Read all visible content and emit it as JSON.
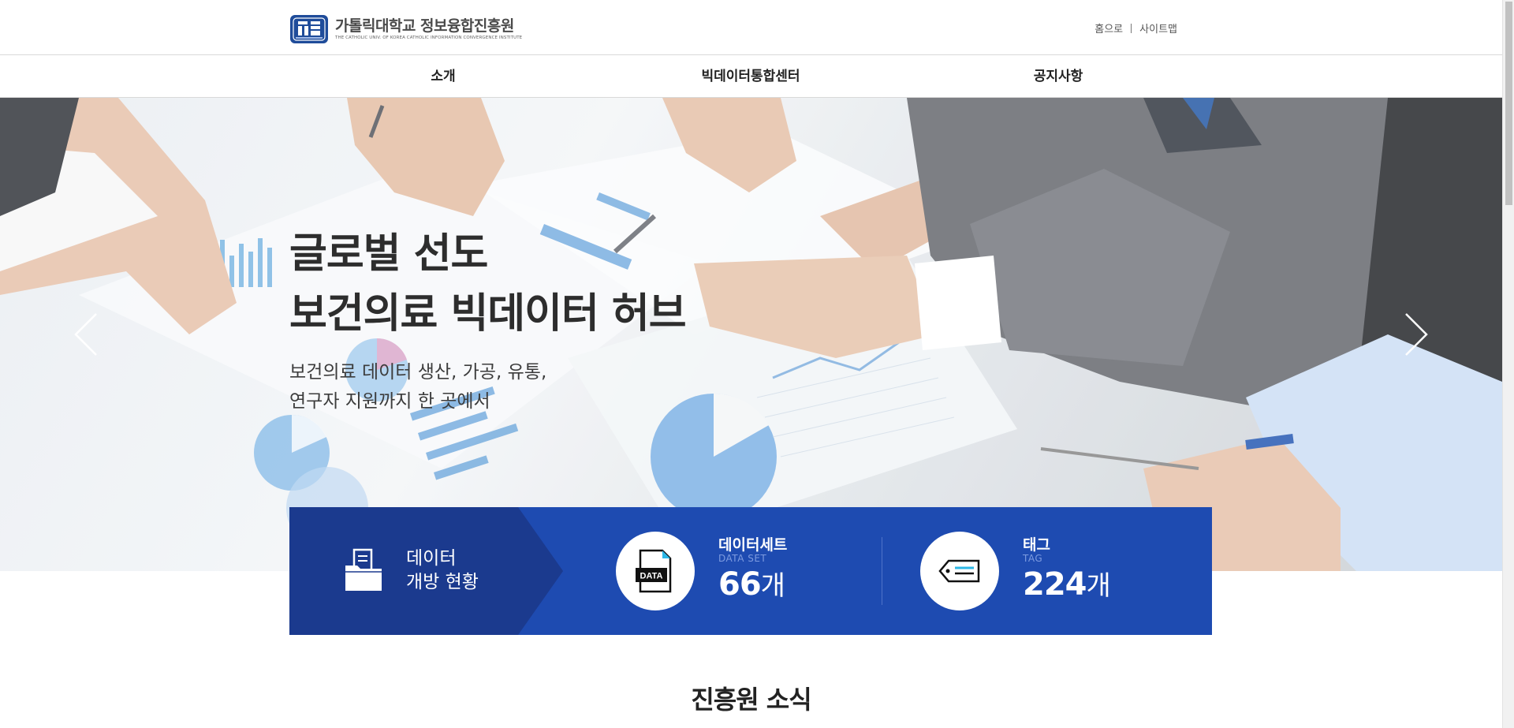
{
  "header": {
    "logo_korean": "가톨릭대학교 정보융합진흥원",
    "logo_english": "THE CATHOLIC UNIV. OF KOREA CATHOLIC INFORMATION CONVERGENCE INSTITUTE",
    "util_links": [
      "홈으로",
      "사이트맵"
    ]
  },
  "gnb": {
    "items": [
      "소개",
      "빅데이터통합센터",
      "공지사항"
    ]
  },
  "hero": {
    "title_line1": "글로벌 선도",
    "title_line2": "보건의료 빅데이터 허브",
    "sub_line1": "보건의료 데이터 생산, 가공, 유통,",
    "sub_line2": "연구자 지원까지 한 곳에서",
    "prev_icon": "chevron-left-icon",
    "next_icon": "chevron-right-icon"
  },
  "stats": {
    "title_line1": "데이터",
    "title_line2": "개방 현황",
    "dataset": {
      "label": "데이터세트",
      "eng": "DATA SET",
      "value": "66",
      "unit": "개",
      "icon_text": "DATA"
    },
    "tag": {
      "label": "태그",
      "eng": "TAG",
      "value": "224",
      "unit": "개"
    },
    "colors": {
      "bar": "#1e4bb1",
      "left_block": "#1b3a8e"
    }
  },
  "section": {
    "title": "진흥원 소식"
  }
}
